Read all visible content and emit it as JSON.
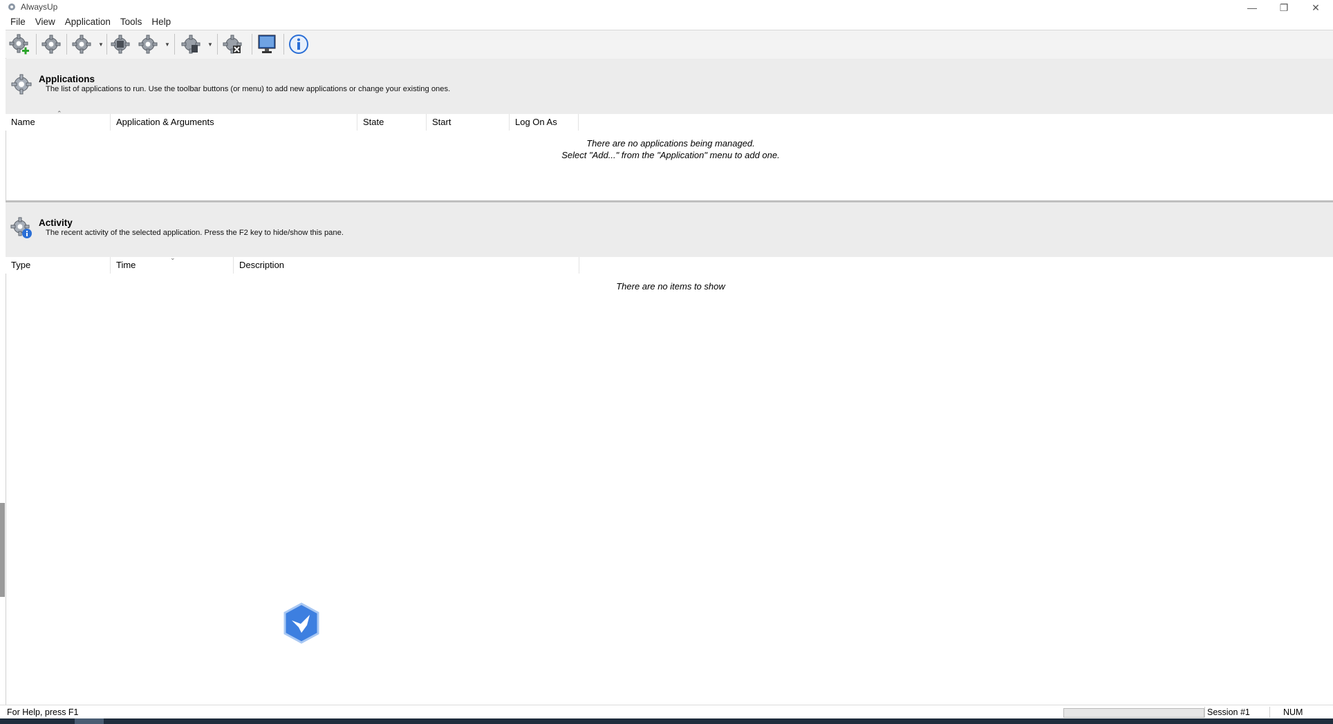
{
  "window": {
    "title": "AlwaysUp"
  },
  "menu": [
    "File",
    "View",
    "Application",
    "Tools",
    "Help"
  ],
  "toolbar": {
    "buttons": [
      {
        "name": "add-application-icon"
      },
      {
        "name": "edit-application-icon"
      },
      {
        "name": "start-application-icon",
        "dropdown": true
      },
      {
        "name": "stop-application-icon"
      },
      {
        "name": "restart-application-icon",
        "dropdown": true
      },
      {
        "name": "application-report-icon",
        "dropdown": true
      },
      {
        "name": "remove-application-icon"
      },
      {
        "name": "monitor-icon"
      },
      {
        "name": "info-icon"
      }
    ]
  },
  "applications": {
    "title": "Applications",
    "description": "The list of applications to run. Use the toolbar buttons (or menu) to add new applications or change your existing ones.",
    "columns": [
      "Name",
      "Application & Arguments",
      "State",
      "Start",
      "Log On As"
    ],
    "empty_line1": "There are no applications being managed.",
    "empty_line2": "Select \"Add...\" from the \"Application\" menu to add one."
  },
  "activity": {
    "title": "Activity",
    "description": "The recent activity of the selected application. Press the F2 key to hide/show this pane.",
    "columns": [
      "Type",
      "Time",
      "Description"
    ],
    "empty": "There are no items to show"
  },
  "status": {
    "help": "For Help, press F1",
    "session": "Session #1",
    "num": "NUM"
  },
  "colors": {
    "pane_header_bg": "#ececec",
    "toolbar_bg": "#f3f3f3",
    "gear": "#9aa0a8",
    "accent_blue": "#2b6fd6"
  }
}
